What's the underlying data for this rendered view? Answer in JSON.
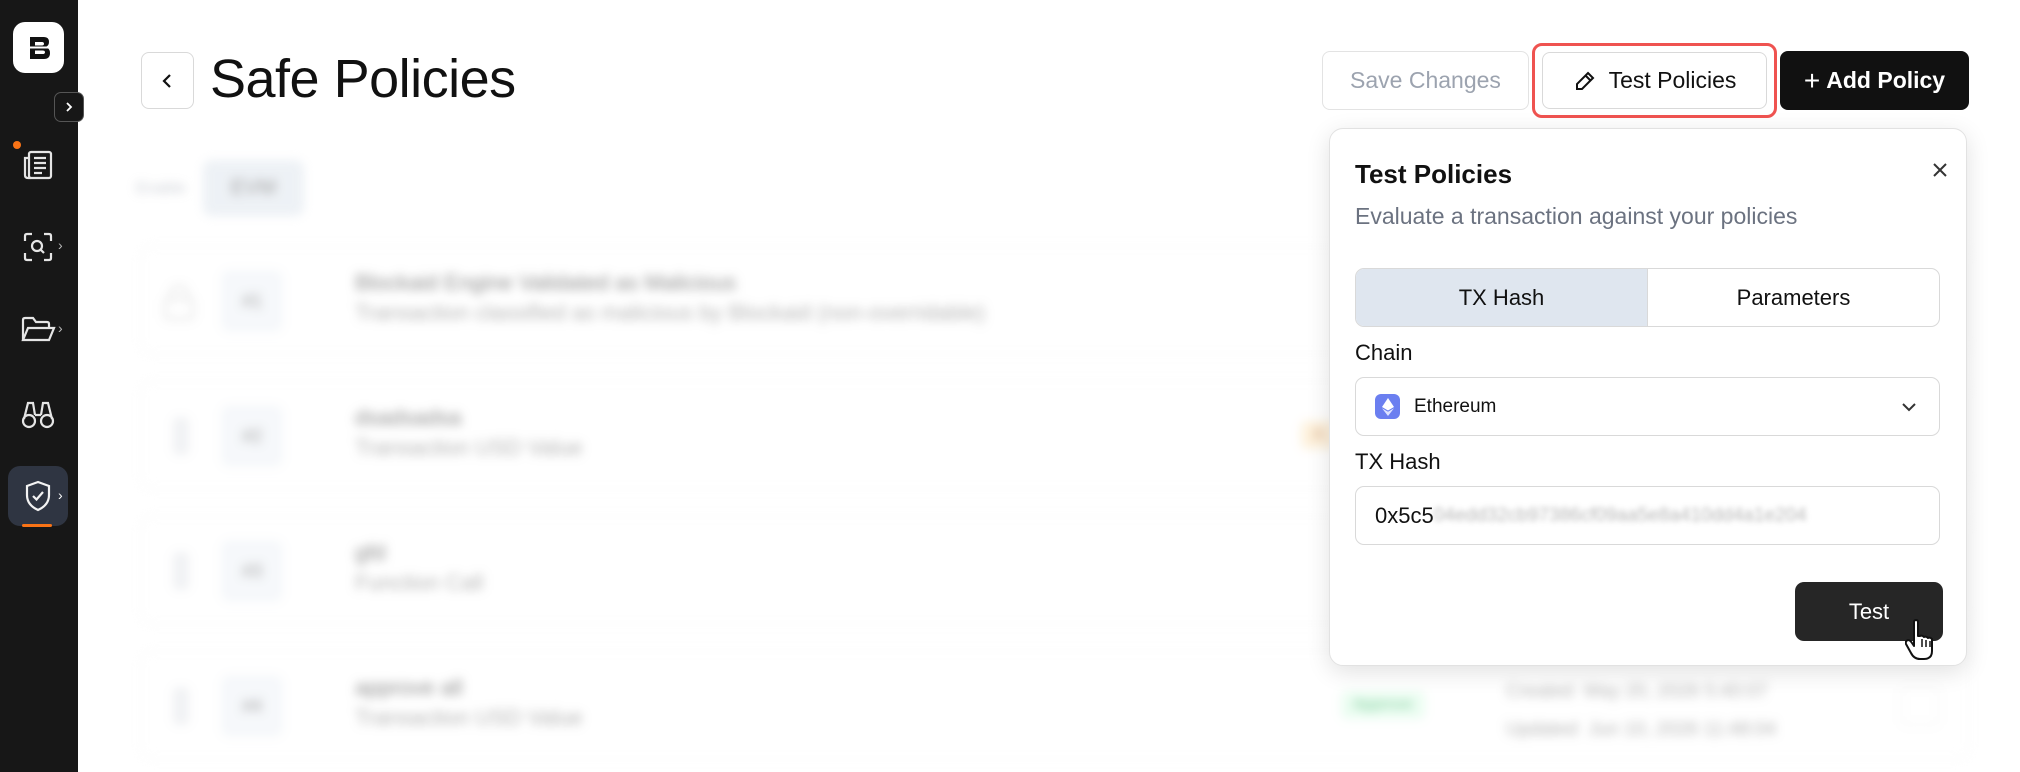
{
  "sidebar": {
    "logo_text": "B",
    "items": [
      {
        "name": "news-icon",
        "has_dot": true
      },
      {
        "name": "scan-icon",
        "has_chevron": true
      },
      {
        "name": "folder-icon",
        "has_chevron": true
      },
      {
        "name": "binoculars-icon"
      },
      {
        "name": "shield-check-icon",
        "has_chevron": true,
        "active": true
      }
    ]
  },
  "header": {
    "title": "Safe Policies",
    "save_label": "Save Changes",
    "test_label": "Test Policies",
    "add_label": "Add Policy",
    "add_prefix": "+"
  },
  "filter": {
    "label": "Enable",
    "chip": "EVM"
  },
  "policies": [
    {
      "num": "#1",
      "title": "Blockaid Engine Validated as Malicious",
      "subtitle": "Transaction classified as malicious by Blockaid (non-overridable)"
    },
    {
      "num": "#2",
      "title": "dsadsadsa",
      "subtitle": "Transaction USD Value",
      "badge": "A"
    },
    {
      "num": "#3",
      "title": "gfd",
      "subtitle": "Function Call"
    },
    {
      "num": "#4",
      "title": "approve all",
      "subtitle": "Transaction USD Value",
      "badge": "Approve",
      "created_label": "Created",
      "created": "May 20, 2026 5:40:07",
      "updated_label": "Updated",
      "updated": "Jun 10, 2026 11:48:04"
    }
  ],
  "popover": {
    "title": "Test Policies",
    "subtitle": "Evaluate a transaction against your policies",
    "tabs": [
      "TX Hash",
      "Parameters"
    ],
    "active_tab": "TX Hash",
    "chain_label": "Chain",
    "chain_value": "Ethereum",
    "hash_label": "TX Hash",
    "hash_visible": "0x5c5",
    "hash_rest": "04edd32cb97386cf09aa5e8a410dd4a1e204",
    "submit_label": "Test"
  },
  "colors": {
    "sidebar_bg": "#171717",
    "accent_orange": "#f97316",
    "highlight_red": "#ef5350",
    "primary_dark": "#111111",
    "eth_blue": "#6b7ff0"
  }
}
